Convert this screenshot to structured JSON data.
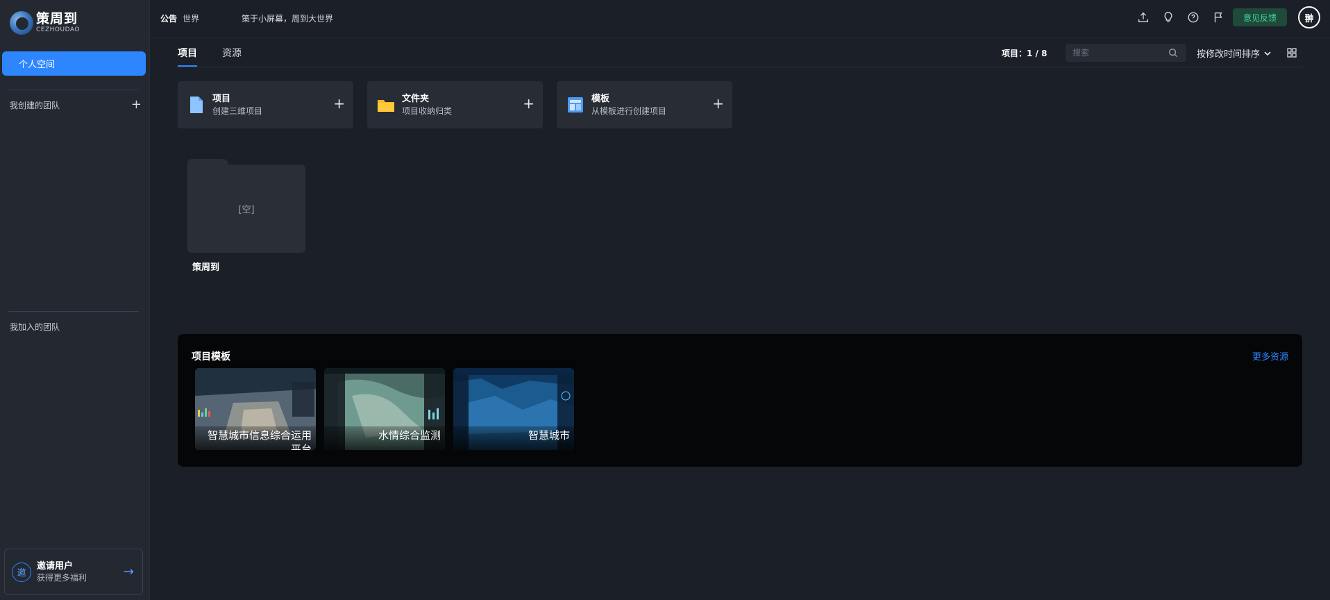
{
  "logo": {
    "cn": "策周到",
    "en": "CEZHOUDAO"
  },
  "sidebar": {
    "personal_space": "个人空间",
    "created_teams": "我创建的团队",
    "joined_teams": "我加入的团队",
    "invite": {
      "badge": "邀",
      "title": "邀请用户",
      "subtitle": "获得更多福利"
    }
  },
  "topbar": {
    "notice_label": "公告",
    "notice_scope": "世界",
    "notice_text": "策于小屏幕，周到大世界",
    "feedback_label": "意见反馈",
    "avatar_text": "翀",
    "icons": [
      "upload-icon",
      "lightbulb-icon",
      "help-icon",
      "flag-icon"
    ]
  },
  "tabs": [
    {
      "label": "项目",
      "active": true
    },
    {
      "label": "资源",
      "active": false
    }
  ],
  "toolbar": {
    "project_count": "项目：1 / 8",
    "search_placeholder": "搜索",
    "sort_label": "按修改时间排序"
  },
  "create_cards": [
    {
      "title": "项目",
      "desc": "创建三维项目",
      "icon": "document-icon"
    },
    {
      "title": "文件夹",
      "desc": "项目收纳归类",
      "icon": "folder-icon"
    },
    {
      "title": "模板",
      "desc": "从模板进行创建项目",
      "icon": "template-icon"
    }
  ],
  "folders": [
    {
      "name": "策周到",
      "content": "[空]"
    }
  ],
  "templates_section": {
    "title": "项目模板",
    "more": "更多资源",
    "items": [
      {
        "label": "智慧城市信息综合运用平台"
      },
      {
        "label": "水情综合监测"
      },
      {
        "label": "智慧城市"
      }
    ]
  },
  "colors": {
    "accent": "#2e86ff",
    "sidebar_bg": "#232831",
    "page_bg": "#1b1f27",
    "feedback_bg": "#1f4a3b",
    "feedback_text": "#43d6a0"
  }
}
